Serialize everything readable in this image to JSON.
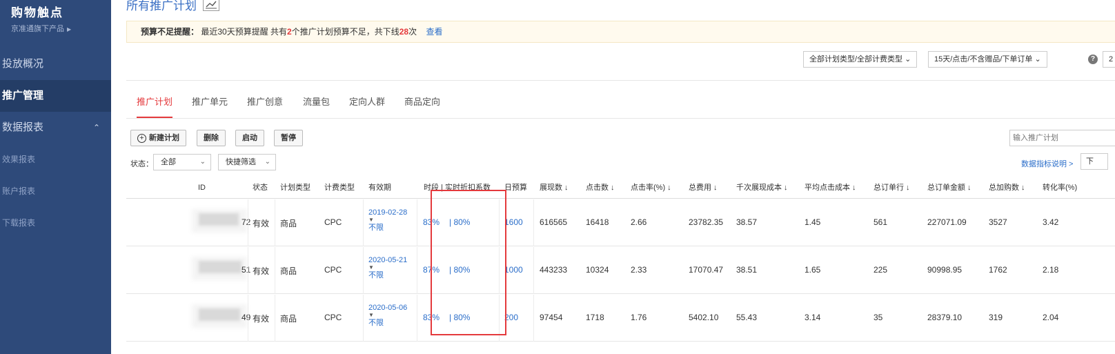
{
  "sidebar": {
    "brand": "购物触点",
    "brand_sub": "京准通旗下产品",
    "items": [
      {
        "label": "投放概况"
      },
      {
        "label": "推广管理"
      },
      {
        "label": "数据报表"
      }
    ],
    "sub_items": [
      {
        "label": "效果报表"
      },
      {
        "label": "账户报表"
      },
      {
        "label": "下载报表"
      }
    ]
  },
  "header": {
    "title": "所有推广计划"
  },
  "alert": {
    "title": "预算不足提醒：",
    "text1": "最近30天预算提醒 共有",
    "count": "2",
    "text2": "个推广计划预算不足，共下线",
    "times": "28",
    "text3": "次",
    "link": "查看"
  },
  "toolbar_top": {
    "plan_type_select": "全部计划类型/全部计费类型",
    "range_select": "15天/点击/不含赠品/下单订单",
    "truncated_select": "2"
  },
  "tabs": [
    {
      "label": "推广计划"
    },
    {
      "label": "推广单元"
    },
    {
      "label": "推广创意"
    },
    {
      "label": "流量包"
    },
    {
      "label": "定向人群"
    },
    {
      "label": "商品定向"
    }
  ],
  "actions": {
    "new_plan": "新建计划",
    "delete": "删除",
    "start": "启动",
    "pause": "暂停",
    "search_placeholder": "输入推广计划"
  },
  "filters": {
    "status_label": "状态：",
    "status_value": "全部",
    "quick_filter": "快捷筛选",
    "metric_link": "数据指标说明 >",
    "download": "下"
  },
  "table": {
    "columns": [
      "ID",
      "状态",
      "计划类型",
      "计费类型",
      "有效期",
      "时段 | 实时折扣系数",
      "日预算",
      "展现数 ↓",
      "点击数 ↓",
      "点击率(%) ↓",
      "总费用 ↓",
      "千次展现成本 ↓",
      "平均点击成本 ↓",
      "总订单行 ↓",
      "总订单金额 ↓",
      "总加购数 ↓",
      "转化率(%)"
    ],
    "rows": [
      {
        "id_tail": "72",
        "status": "有效",
        "plan_type": "商品",
        "bill_type": "CPC",
        "start": "2019-02-28",
        "end": "不限",
        "period": "83%",
        "discount": "| 80%",
        "budget": "1600",
        "impressions": "616565",
        "clicks": "16418",
        "ctr": "2.66",
        "cost": "23782.35",
        "cpm": "38.57",
        "cpc": "1.45",
        "orders": "561",
        "order_amount": "227071.09",
        "carts": "3527",
        "cvr": "3.42"
      },
      {
        "id_tail": "51",
        "status": "有效",
        "plan_type": "商品",
        "bill_type": "CPC",
        "start": "2020-05-21",
        "end": "不限",
        "period": "87%",
        "discount": "| 80%",
        "budget": "1000",
        "impressions": "443233",
        "clicks": "10324",
        "ctr": "2.33",
        "cost": "17070.47",
        "cpm": "38.51",
        "cpc": "1.65",
        "orders": "225",
        "order_amount": "90998.95",
        "carts": "1762",
        "cvr": "2.18"
      },
      {
        "id_tail": "49",
        "status": "有效",
        "plan_type": "商品",
        "bill_type": "CPC",
        "start": "2020-05-06",
        "end": "不限",
        "period": "83%",
        "discount": "| 80%",
        "budget": "200",
        "impressions": "97454",
        "clicks": "1718",
        "ctr": "1.76",
        "cost": "5402.10",
        "cpm": "55.43",
        "cpc": "3.14",
        "orders": "35",
        "order_amount": "28379.10",
        "carts": "319",
        "cvr": "2.04"
      }
    ]
  }
}
